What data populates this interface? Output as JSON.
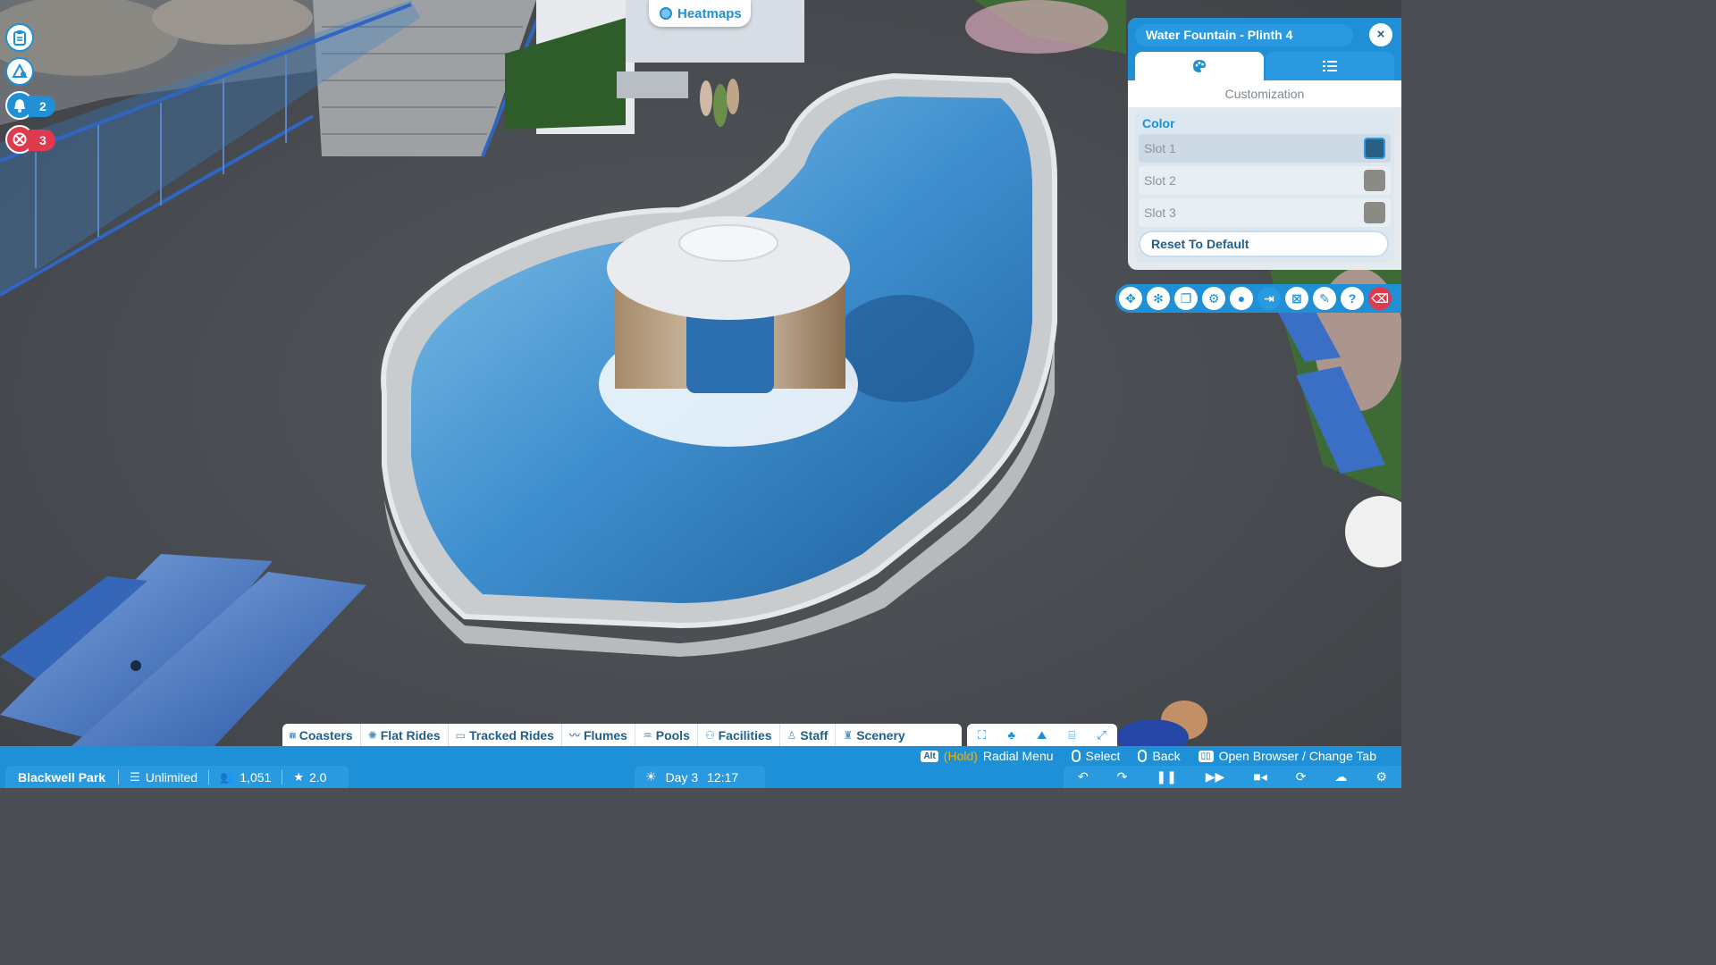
{
  "heatmaps": {
    "label": "Heatmaps"
  },
  "notifications": [
    {
      "icon": "clipboard-icon",
      "count": ""
    },
    {
      "icon": "guest-thoughts-icon",
      "count": ""
    },
    {
      "icon": "bell-icon",
      "count": "2"
    },
    {
      "icon": "alert-icon",
      "count": "3"
    }
  ],
  "panel": {
    "title": "Water Fountain - Plinth 4",
    "close_label": "×",
    "tabs": [
      {
        "icon": "palette-icon",
        "active": true
      },
      {
        "icon": "list-icon",
        "active": false
      }
    ],
    "subheading": "Customization",
    "color_section_label": "Color",
    "slots": [
      {
        "label": "Slot 1",
        "color": "#2b5f82",
        "selected": true
      },
      {
        "label": "Slot 2",
        "color": "#8b8b86",
        "selected": false
      },
      {
        "label": "Slot 3",
        "color": "#8b8b86",
        "selected": false
      }
    ],
    "reset_label": "Reset To Default"
  },
  "tools": [
    "move-icon",
    "advanced-move-icon",
    "duplicate-icon",
    "settings-icon",
    "locate-icon",
    "exit-icon",
    "resize-icon",
    "edit-icon",
    "help-icon",
    "delete-icon"
  ],
  "categories": [
    {
      "label": "Coasters",
      "icon": "coaster-icon"
    },
    {
      "label": "Flat Rides",
      "icon": "flat-ride-icon"
    },
    {
      "label": "Tracked Rides",
      "icon": "tracked-ride-icon"
    },
    {
      "label": "Flumes",
      "icon": "flume-icon"
    },
    {
      "label": "Pools",
      "icon": "pool-icon"
    },
    {
      "label": "Facilities",
      "icon": "facilities-icon"
    },
    {
      "label": "Staff",
      "icon": "staff-icon"
    },
    {
      "label": "Scenery",
      "icon": "scenery-icon"
    }
  ],
  "hints": {
    "alt_key": "Alt",
    "hold": "(Hold)",
    "radial_menu": "Radial Menu",
    "select": "Select",
    "back": "Back",
    "open_browser": "Open Browser / Change Tab"
  },
  "park": {
    "name": "Blackwell Park",
    "money": "Unlimited",
    "guests": "1,051",
    "rating": "2.0"
  },
  "time": {
    "day": "Day 3",
    "clock": "12:17"
  },
  "colors": {
    "accent": "#1f8fd6",
    "alert": "#e03a4f",
    "water": "#3f8fcf",
    "asphalt": "#4c4f54"
  }
}
